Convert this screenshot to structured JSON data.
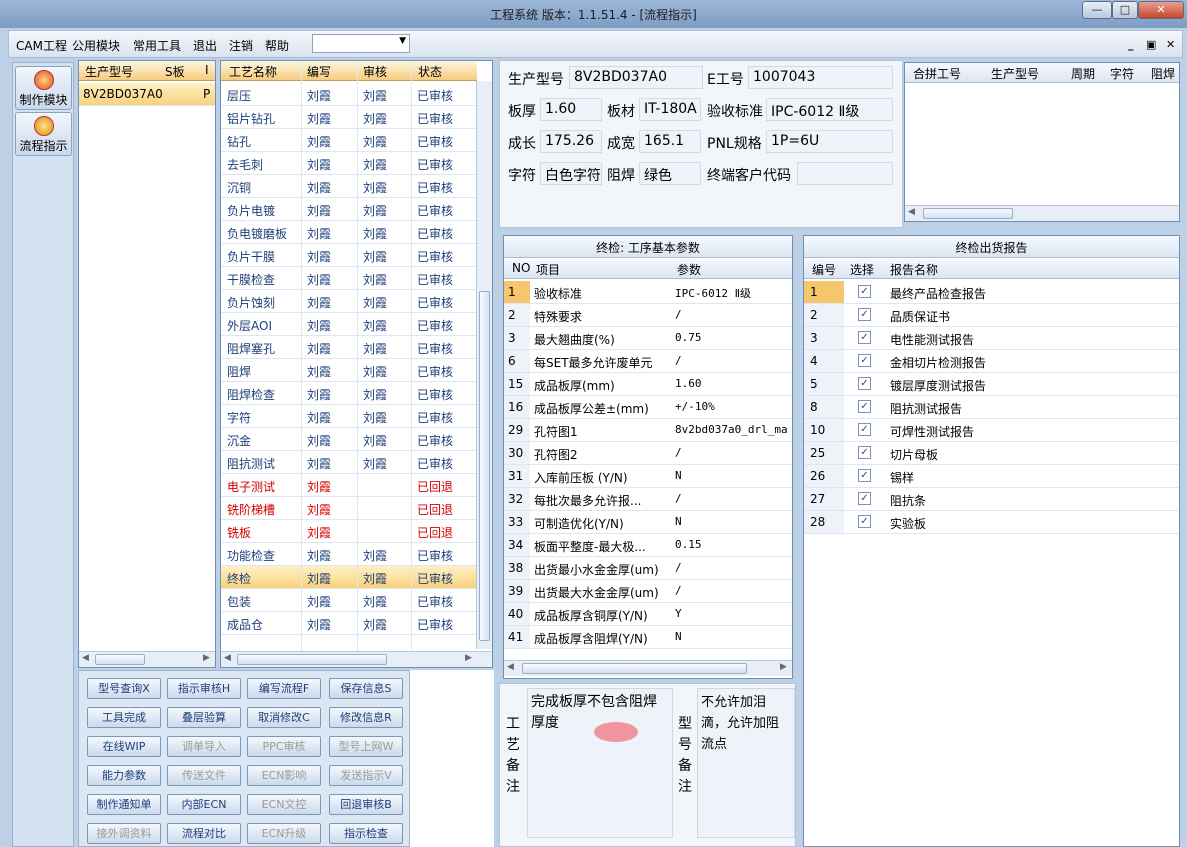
{
  "window": {
    "title": "工程系统   版本：1.1.51.4 - [流程指示]",
    "min_label": "—",
    "max_label": "□",
    "close_label": "✕"
  },
  "menu": {
    "items": [
      "CAM工程",
      "公用模块",
      "常用工具",
      "退出",
      "注销",
      "帮助"
    ],
    "combo_value": ""
  },
  "sidebar": {
    "buttons": [
      {
        "label": "制作模块",
        "icon": "flame-icon"
      },
      {
        "label": "流程指示",
        "icon": "flow-icon"
      }
    ]
  },
  "model_list": {
    "headers": [
      "生产型号",
      "S板",
      "I"
    ],
    "rows": [
      {
        "model": "8V2BD037A0",
        "s": "P"
      }
    ]
  },
  "process_list": {
    "headers": [
      "工艺名称",
      "编写",
      "审核",
      "状态"
    ],
    "rows": [
      {
        "name": "层压",
        "writer": "刘霞",
        "reviewer": "刘霞",
        "status": "已审核",
        "returned": false
      },
      {
        "name": "铝片钻孔",
        "writer": "刘霞",
        "reviewer": "刘霞",
        "status": "已审核",
        "returned": false
      },
      {
        "name": "钻孔",
        "writer": "刘霞",
        "reviewer": "刘霞",
        "status": "已审核",
        "returned": false
      },
      {
        "name": "去毛刺",
        "writer": "刘霞",
        "reviewer": "刘霞",
        "status": "已审核",
        "returned": false
      },
      {
        "name": "沉铜",
        "writer": "刘霞",
        "reviewer": "刘霞",
        "status": "已审核",
        "returned": false
      },
      {
        "name": "负片电镀",
        "writer": "刘霞",
        "reviewer": "刘霞",
        "status": "已审核",
        "returned": false
      },
      {
        "name": "负电镀磨板",
        "writer": "刘霞",
        "reviewer": "刘霞",
        "status": "已审核",
        "returned": false
      },
      {
        "name": "负片干膜",
        "writer": "刘霞",
        "reviewer": "刘霞",
        "status": "已审核",
        "returned": false
      },
      {
        "name": "干膜检查",
        "writer": "刘霞",
        "reviewer": "刘霞",
        "status": "已审核",
        "returned": false
      },
      {
        "name": "负片蚀刻",
        "writer": "刘霞",
        "reviewer": "刘霞",
        "status": "已审核",
        "returned": false
      },
      {
        "name": "外层AOI",
        "writer": "刘霞",
        "reviewer": "刘霞",
        "status": "已审核",
        "returned": false
      },
      {
        "name": "阻焊塞孔",
        "writer": "刘霞",
        "reviewer": "刘霞",
        "status": "已审核",
        "returned": false
      },
      {
        "name": "阻焊",
        "writer": "刘霞",
        "reviewer": "刘霞",
        "status": "已审核",
        "returned": false
      },
      {
        "name": "阻焊检查",
        "writer": "刘霞",
        "reviewer": "刘霞",
        "status": "已审核",
        "returned": false
      },
      {
        "name": "字符",
        "writer": "刘霞",
        "reviewer": "刘霞",
        "status": "已审核",
        "returned": false
      },
      {
        "name": "沉金",
        "writer": "刘霞",
        "reviewer": "刘霞",
        "status": "已审核",
        "returned": false
      },
      {
        "name": "阻抗测试",
        "writer": "刘霞",
        "reviewer": "刘霞",
        "status": "已审核",
        "returned": false
      },
      {
        "name": "电子测试",
        "writer": "刘霞",
        "reviewer": "",
        "status": "已回退",
        "returned": true
      },
      {
        "name": "铣阶梯槽",
        "writer": "刘霞",
        "reviewer": "",
        "status": "已回退",
        "returned": true
      },
      {
        "name": "铣板",
        "writer": "刘霞",
        "reviewer": "",
        "status": "已回退",
        "returned": true
      },
      {
        "name": "功能检查",
        "writer": "刘霞",
        "reviewer": "刘霞",
        "status": "已审核",
        "returned": false
      },
      {
        "name": "终检",
        "writer": "刘霞",
        "reviewer": "刘霞",
        "status": "已审核",
        "returned": false
      },
      {
        "name": "包装",
        "writer": "刘霞",
        "reviewer": "刘霞",
        "status": "已审核",
        "returned": false
      },
      {
        "name": "成品仓",
        "writer": "刘霞",
        "reviewer": "刘霞",
        "status": "已审核",
        "returned": false
      }
    ],
    "selected_index": 21
  },
  "info": {
    "model_label": "生产型号",
    "model_value": "8V2BD037A0",
    "eno_label": "E工号",
    "eno_value": "1007043",
    "thickness_label": "板厚",
    "thickness_value": "1.60",
    "material_label": "板材",
    "material_value": "IT-180A",
    "standard_label": "验收标准",
    "standard_value": "IPC-6012 Ⅱ级",
    "length_label": "成长",
    "length_value": "175.26",
    "width_label": "成宽",
    "width_value": "165.1",
    "pnl_label": "PNL规格",
    "pnl_value": "1P=6U",
    "char_label": "字符",
    "char_value": "白色字符",
    "mask_label": "阻焊",
    "mask_value": "绿色",
    "customer_label": "终端客户代码",
    "customer_value": ""
  },
  "merge_table": {
    "headers": [
      "合拼工号",
      "生产型号",
      "周期",
      "字符",
      "阻焊"
    ]
  },
  "params": {
    "title": "终检: 工序基本参数",
    "headers": [
      "NO",
      "项目",
      "参数"
    ],
    "rows": [
      {
        "no": "1",
        "item": "验收标准",
        "value": "IPC-6012 Ⅱ级"
      },
      {
        "no": "2",
        "item": "特殊要求",
        "value": "/"
      },
      {
        "no": "3",
        "item": "最大翘曲度(%)",
        "value": "0.75"
      },
      {
        "no": "6",
        "item": "每SET最多允许废单元",
        "value": "/"
      },
      {
        "no": "15",
        "item": "成品板厚(mm)",
        "value": "1.60"
      },
      {
        "no": "16",
        "item": "成品板厚公差±(mm)",
        "value": "+/-10%"
      },
      {
        "no": "29",
        "item": "孔符图1",
        "value": "8v2bd037a0_drl_ma"
      },
      {
        "no": "30",
        "item": "孔符图2",
        "value": "/"
      },
      {
        "no": "31",
        "item": "入库前压板 (Y/N)",
        "value": "N"
      },
      {
        "no": "32",
        "item": "每批次最多允许报...",
        "value": "/"
      },
      {
        "no": "33",
        "item": "可制造优化(Y/N)",
        "value": "N"
      },
      {
        "no": "34",
        "item": "板面平整度-最大极...",
        "value": "0.15"
      },
      {
        "no": "38",
        "item": "出货最小水金金厚(um)",
        "value": "/"
      },
      {
        "no": "39",
        "item": "出货最大水金金厚(um)",
        "value": "/"
      },
      {
        "no": "40",
        "item": "成品板厚含铜厚(Y/N)",
        "value": "Y"
      },
      {
        "no": "41",
        "item": "成品板厚含阻焊(Y/N)",
        "value": "N"
      }
    ]
  },
  "report": {
    "title": "终检出货报告",
    "headers": [
      "编号",
      "选择",
      "报告名称"
    ],
    "rows": [
      {
        "no": "1",
        "checked": true,
        "name": "最终产品检查报告"
      },
      {
        "no": "2",
        "checked": true,
        "name": "品质保证书"
      },
      {
        "no": "3",
        "checked": true,
        "name": "电性能测试报告"
      },
      {
        "no": "4",
        "checked": true,
        "name": "金相切片检测报告"
      },
      {
        "no": "5",
        "checked": true,
        "name": "镀层厚度测试报告"
      },
      {
        "no": "8",
        "checked": true,
        "name": "阻抗测试报告"
      },
      {
        "no": "10",
        "checked": true,
        "name": "可焊性测试报告"
      },
      {
        "no": "25",
        "checked": true,
        "name": "切片母板"
      },
      {
        "no": "26",
        "checked": true,
        "name": "锡样"
      },
      {
        "no": "27",
        "checked": true,
        "name": "阻抗条"
      },
      {
        "no": "28",
        "checked": true,
        "name": "实验板"
      }
    ]
  },
  "buttons": [
    {
      "label": "型号查询X",
      "enabled": true
    },
    {
      "label": "指示审核H",
      "enabled": true
    },
    {
      "label": "编写流程F",
      "enabled": true
    },
    {
      "label": "保存信息S",
      "enabled": true
    },
    {
      "label": "工具完成",
      "enabled": true
    },
    {
      "label": "叠层验算",
      "enabled": true
    },
    {
      "label": "取消修改C",
      "enabled": true
    },
    {
      "label": "修改信息R",
      "enabled": true
    },
    {
      "label": "在线WIP",
      "enabled": true
    },
    {
      "label": "调单导入",
      "enabled": false
    },
    {
      "label": "PPC审核",
      "enabled": false
    },
    {
      "label": "型号上网W",
      "enabled": false
    },
    {
      "label": "能力参数",
      "enabled": true
    },
    {
      "label": "传送文件",
      "enabled": false
    },
    {
      "label": "ECN影响",
      "enabled": false
    },
    {
      "label": "发送指示V",
      "enabled": false
    },
    {
      "label": "制作通知单",
      "enabled": true
    },
    {
      "label": "内部ECN",
      "enabled": true
    },
    {
      "label": "ECN文控",
      "enabled": false
    },
    {
      "label": "回退审核B",
      "enabled": true
    },
    {
      "label": "接外调资料",
      "enabled": false
    },
    {
      "label": "流程对比",
      "enabled": true
    },
    {
      "label": "ECN升级",
      "enabled": false
    },
    {
      "label": "指示检查",
      "enabled": true
    }
  ],
  "remarks": {
    "process_label": "工艺备注",
    "process_text": "完成板厚不包含阻焊厚度",
    "model_label": "型号备注",
    "model_text": "不允许加泪滴，允许加阻流点"
  },
  "colors": {
    "accent": "#f5c66b",
    "returned": "#d40000",
    "link": "#1d3f7a"
  }
}
